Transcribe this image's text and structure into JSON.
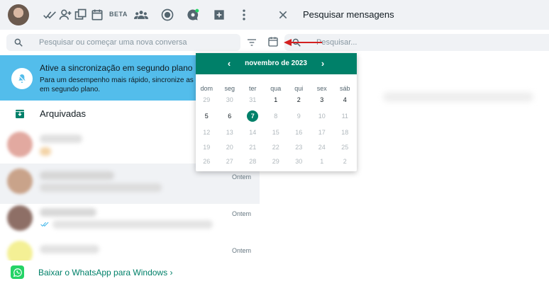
{
  "left_header": {
    "beta_label": "BETA"
  },
  "right_header": {
    "title": "Pesquisar mensagens"
  },
  "search": {
    "placeholder": "Pesquisar ou começar uma nova conversa"
  },
  "message_search": {
    "placeholder": "Pesquisar..."
  },
  "sync_banner": {
    "title": "Ative a sincronização em segundo plano",
    "body_line1": "Para um desempenho mais rápido, sincronize as c",
    "body_line2": "em segundo plano."
  },
  "archived": {
    "label": "Arquivadas"
  },
  "chats": [
    {
      "time": ""
    },
    {
      "time": "Ontem"
    },
    {
      "time": "Ontem"
    },
    {
      "time": "Ontem"
    }
  ],
  "download": {
    "label": "Baixar o WhatsApp para Windows",
    "chevron": "›"
  },
  "calendar": {
    "month_label": "novembro de 2023",
    "prev": "‹",
    "next": "›",
    "weekdays": [
      "dom",
      "seg",
      "ter",
      "qua",
      "qui",
      "sex",
      "sáb"
    ],
    "weeks": [
      [
        "29",
        "30",
        "31",
        "1",
        "2",
        "3",
        "4"
      ],
      [
        "5",
        "6",
        "7",
        "8",
        "9",
        "10",
        "11"
      ],
      [
        "12",
        "13",
        "14",
        "15",
        "16",
        "17",
        "18"
      ],
      [
        "19",
        "20",
        "21",
        "22",
        "23",
        "24",
        "25"
      ],
      [
        "26",
        "27",
        "28",
        "29",
        "30",
        "1",
        "2"
      ]
    ],
    "selected_day": "7"
  },
  "colors": {
    "accent": "#008069",
    "banner": "#53bdeb",
    "whatsapp_green": "#25d366"
  }
}
